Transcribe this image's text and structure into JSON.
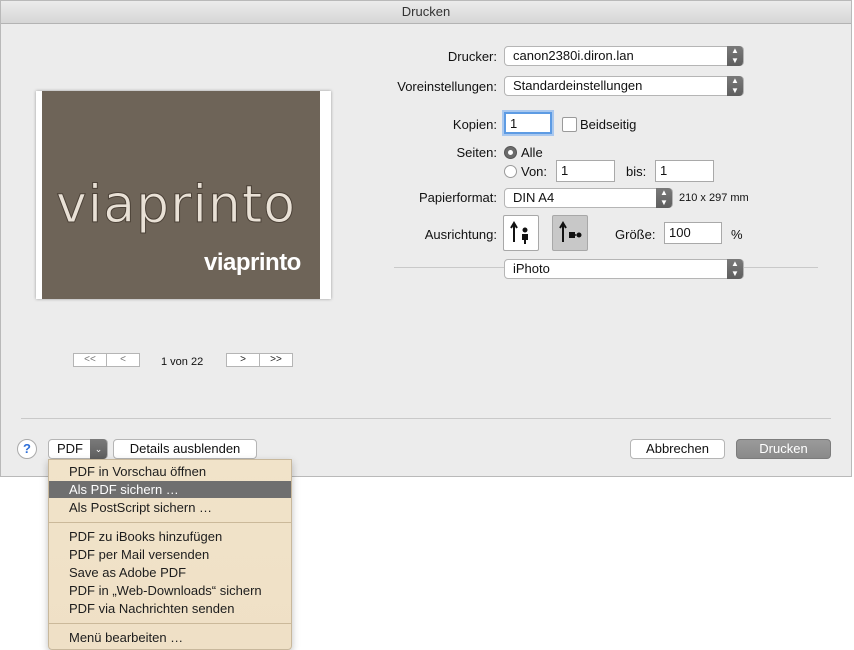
{
  "window": {
    "title": "Drucken"
  },
  "preview": {
    "logo_text": "viaprinto",
    "brand_text": "viaprinto",
    "page_indicator": "1 von 22",
    "first_glyph": "<<",
    "prev_glyph": "<",
    "next_glyph": ">",
    "last_glyph": ">>"
  },
  "settings": {
    "printer_label": "Drucker:",
    "printer_value": "canon2380i.diron.lan",
    "presets_label": "Voreinstellungen:",
    "presets_value": "Standardeinstellungen",
    "copies_label": "Kopien:",
    "copies_value": "1",
    "duplex_label": "Beidseitig",
    "duplex_checked": false,
    "pages_label": "Seiten:",
    "pages_all_label": "Alle",
    "pages_from_label": "Von:",
    "pages_from_value": "1",
    "pages_to_label": "bis:",
    "pages_to_value": "1",
    "paper_label": "Papierformat:",
    "paper_value": "DIN A4",
    "paper_size": "210 x 297 mm",
    "orientation_label": "Ausrichtung:",
    "scale_label": "Größe:",
    "scale_value": "100",
    "scale_unit": "%",
    "app_section_value": "iPhoto"
  },
  "footer": {
    "help_glyph": "?",
    "pdf_label": "PDF",
    "pdf_arrow_glyph": "⌄",
    "details_label": "Details ausblenden",
    "cancel_label": "Abbrechen",
    "print_label": "Drucken"
  },
  "pdf_menu": {
    "items": [
      "PDF in Vorschau öffnen",
      "Als PDF sichern …",
      "Als PostScript sichern …",
      "PDF zu iBooks hinzufügen",
      "PDF per Mail versenden",
      "Save as Adobe PDF",
      "PDF in „Web-Downloads“ sichern",
      "PDF via Nachrichten senden",
      "Menü bearbeiten …"
    ],
    "highlighted_index": 1
  },
  "colors": {
    "accent": "#5d9be3",
    "menu_bg": "#f0e2c7",
    "highlight": "#6f6f6f"
  }
}
